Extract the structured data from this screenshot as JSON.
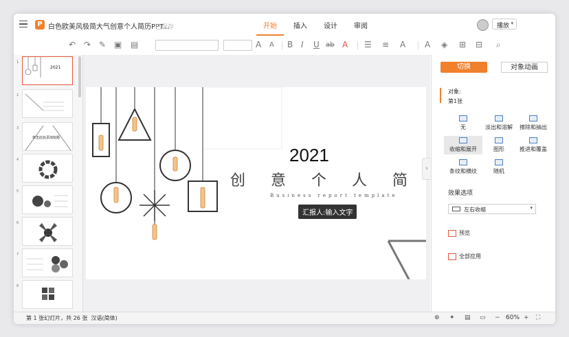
{
  "titlebar": {
    "menu_icon": "hamburger-icon",
    "logo_letter": "P",
    "doc_title": "白色欧美风极简大气创意个人简历PPT...",
    "save_status": "已保存",
    "tabs": [
      {
        "label": "开始",
        "active": true
      },
      {
        "label": "插入",
        "active": false
      },
      {
        "label": "设计",
        "active": false
      },
      {
        "label": "审阅",
        "active": false
      }
    ],
    "play_label": "播放"
  },
  "toolbar": {
    "undo": "↶",
    "redo": "↷",
    "format_painter": "✎",
    "clear": "▣",
    "layout": "▤",
    "grow": "A",
    "shrink": "A",
    "bold": "B",
    "italic": "I",
    "underline": "U",
    "strike": "ab",
    "color": "A",
    "list": "☰",
    "align": "≡",
    "spacing": "A",
    "textbox": "A",
    "shape": "◈",
    "table": "⊞",
    "arrange": "⊟",
    "find": "⌕"
  },
  "thumbnails": [
    {
      "index": "1",
      "title": "2021",
      "selected": true
    },
    {
      "index": "2",
      "title": "",
      "selected": false
    },
    {
      "index": "3",
      "title": "单击此处添加标题",
      "selected": false
    },
    {
      "index": "4",
      "title": "",
      "selected": false
    },
    {
      "index": "5",
      "title": "",
      "selected": false
    },
    {
      "index": "6",
      "title": "",
      "selected": false
    },
    {
      "index": "7",
      "title": "",
      "selected": false
    },
    {
      "index": "8",
      "title": "",
      "selected": false
    }
  ],
  "slide": {
    "year": "2021",
    "title": "创 意 个 人 简",
    "subtitle": "Business report template",
    "tag": "汇报人:输入文字"
  },
  "panel": {
    "tab_transition": "切换",
    "tab_animation": "对象动画",
    "object_label": "对象:",
    "object_value": "第1张",
    "effects": [
      "无",
      "淡出和溶解",
      "擦除和抽出",
      "收缩和展开",
      "图形",
      "推进和覆盖",
      "条纹和横纹",
      "随机"
    ],
    "options_label": "效果选项",
    "option_value": "左右收缩",
    "preview": "预览",
    "apply_all": "全部应用"
  },
  "status": {
    "slide_info": "第 1 张幻灯片，共 26 张",
    "language": "汉语(简体)",
    "zoom": "60%"
  }
}
